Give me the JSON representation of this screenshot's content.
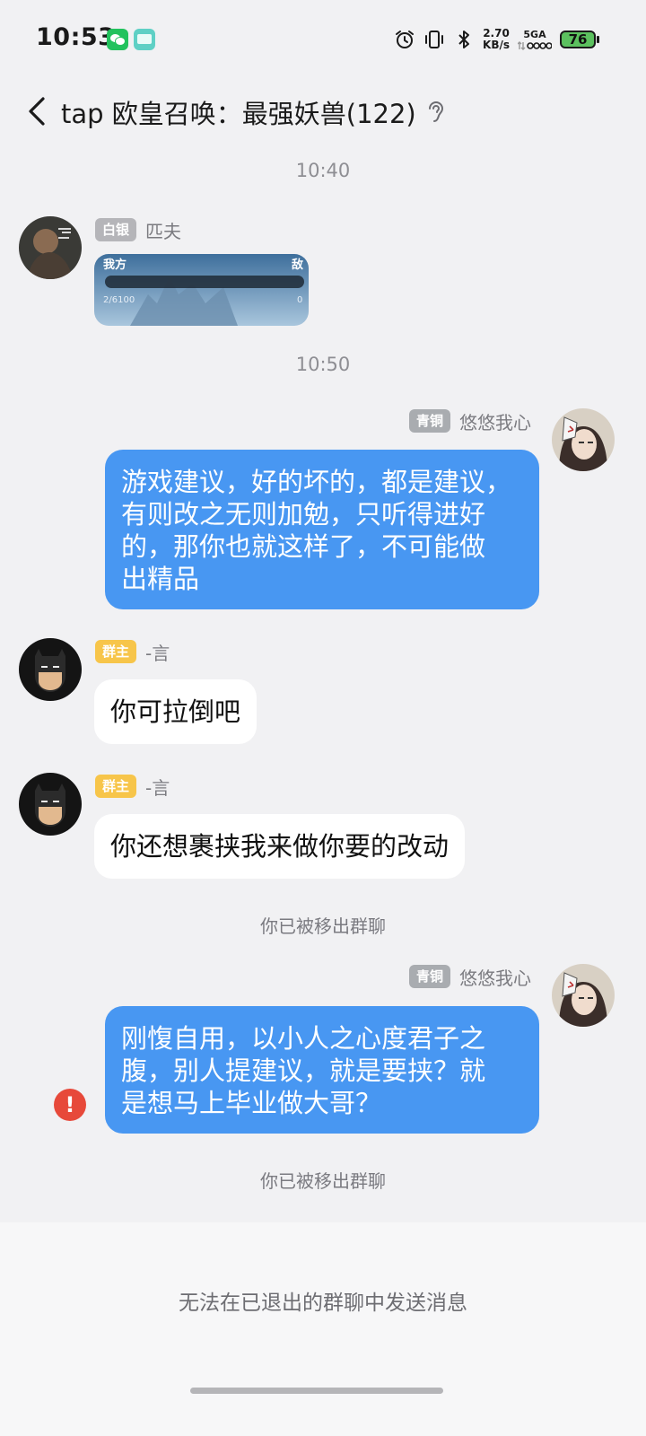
{
  "status_bar": {
    "time": "10:53",
    "net_speed_value": "2.70",
    "net_speed_unit": "KB/s",
    "signal_label": "5GA",
    "battery": "76",
    "icons": [
      "wechat-notification-icon",
      "message-notification-icon",
      "alarm-icon",
      "vibrate-icon",
      "bluetooth-icon",
      "signal-icon",
      "battery-icon"
    ]
  },
  "header": {
    "title": "tap 欧皇召唤：最强妖兽(122)",
    "back_icon": "chevron-left-icon",
    "ear_icon": "ear-icon"
  },
  "messages": [
    {
      "type": "time",
      "text": "10:40"
    },
    {
      "type": "image",
      "direction": "in",
      "badge": "白银",
      "sender": "匹夫",
      "image_text_left": "我方",
      "image_text_hp": "2/6100",
      "image_text_right": "敌",
      "image_text_right2": "0"
    },
    {
      "type": "time",
      "text": "10:50"
    },
    {
      "type": "text",
      "direction": "out",
      "badge": "青铜",
      "sender": "悠悠我心",
      "lines": [
        "游戏建议，好的坏的，都是建议，",
        "有则改之无则加勉，只听得进好",
        "的，那你也就这样了，不可能做",
        "出精品"
      ]
    },
    {
      "type": "text",
      "direction": "in",
      "badge": "群主",
      "sender": "-言",
      "lines": [
        "你可拉倒吧"
      ]
    },
    {
      "type": "text",
      "direction": "in",
      "badge": "群主",
      "sender": "-言",
      "lines": [
        "你还想裹挟我来做你要的改动"
      ]
    },
    {
      "type": "system",
      "text": "你已被移出群聊"
    },
    {
      "type": "text",
      "direction": "out",
      "badge": "青铜",
      "sender": "悠悠我心",
      "lines": [
        "刚愎自用，以小人之心度君子之",
        "腹，别人提建议，就是要挟？就",
        "是想马上毕业做大哥？"
      ],
      "failed": true,
      "error_glyph": "!"
    },
    {
      "type": "system",
      "text": "你已被移出群聊"
    }
  ],
  "footer": {
    "notice": "无法在已退出的群聊中发送消息"
  },
  "colors": {
    "background": "#f1f1f3",
    "outgoing_bubble": "#4897f2",
    "incoming_bubble": "#ffffff",
    "owner_badge": "#f7c54a",
    "rank_badge": "#b5b5b9",
    "error": "#e7493a"
  }
}
